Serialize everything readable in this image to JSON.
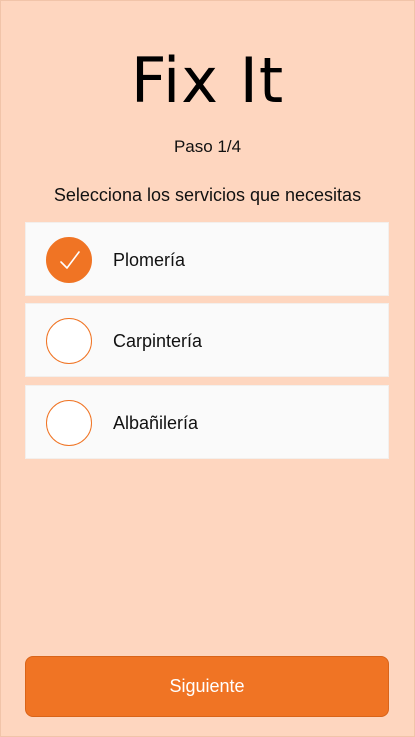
{
  "app": {
    "title": "Fix It"
  },
  "wizard": {
    "step_label": "Paso 1/4",
    "instruction": "Selecciona los servicios que necesitas"
  },
  "services": [
    {
      "label": "Plomería",
      "selected": true
    },
    {
      "label": "Carpintería",
      "selected": false
    },
    {
      "label": "Albañilería",
      "selected": false
    }
  ],
  "actions": {
    "next_label": "Siguiente"
  },
  "colors": {
    "background": "#fed6bf",
    "accent": "#f07424",
    "card": "#fafafa"
  },
  "icons": {
    "selected_indicator": "check-icon"
  }
}
